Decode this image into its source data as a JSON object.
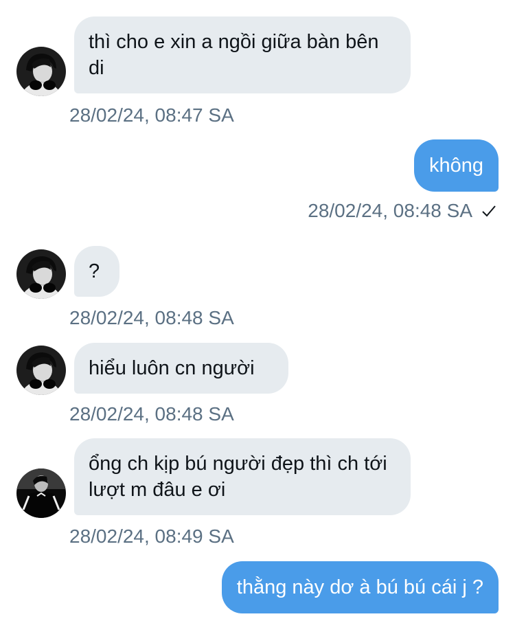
{
  "messages": [
    {
      "direction": "incoming",
      "text": "thì cho e xin a ngồi giữa bàn bên di",
      "timestamp": "28/02/24, 08:47 SA",
      "avatar": "profile-headphones-icon"
    },
    {
      "direction": "outgoing",
      "text": "không",
      "timestamp": "28/02/24, 08:48 SA",
      "status_icon": "check-icon"
    },
    {
      "direction": "incoming",
      "text": "?",
      "timestamp": "28/02/24, 08:48 SA",
      "avatar": "profile-headphones-icon"
    },
    {
      "direction": "incoming",
      "text": "hiểu luôn cn người",
      "timestamp": "28/02/24, 08:48 SA",
      "avatar": "profile-headphones-icon"
    },
    {
      "direction": "incoming",
      "text": "ổng ch kịp bú người đẹp thì ch tới lượt m đâu e ơi",
      "timestamp": "28/02/24, 08:49 SA",
      "avatar": "profile-jacket-icon"
    },
    {
      "direction": "outgoing",
      "text": "thằng này dơ à bú bú cái j ?",
      "timestamp": ""
    }
  ],
  "colors": {
    "incoming_bubble": "#e6ebef",
    "outgoing_bubble": "#4a9ce9",
    "timestamp_text": "#5b7083",
    "message_text": "#0f1419"
  }
}
